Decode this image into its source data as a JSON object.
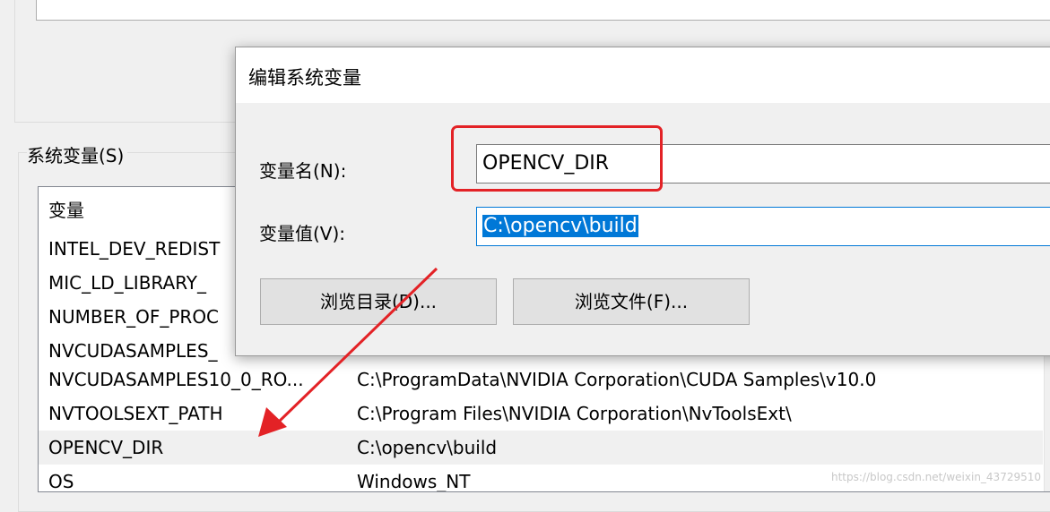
{
  "system_vars": {
    "label": "系统变量(S)",
    "header": "变量",
    "rows": [
      {
        "name": "INTEL_DEV_REDIST",
        "value": ""
      },
      {
        "name": "MIC_LD_LIBRARY_",
        "value": ""
      },
      {
        "name": "NUMBER_OF_PROC",
        "value": ""
      },
      {
        "name": "NVCUDASAMPLES_",
        "value": ""
      },
      {
        "name": "NVCUDASAMPLES10_0_RO...",
        "value": "C:\\ProgramData\\NVIDIA Corporation\\CUDA Samples\\v10.0"
      },
      {
        "name": "NVTOOLSEXT_PATH",
        "value": "C:\\Program Files\\NVIDIA Corporation\\NvToolsExt\\"
      },
      {
        "name": "OPENCV_DIR",
        "value": "C:\\opencv\\build"
      },
      {
        "name": "OS",
        "value": "Windows_NT"
      }
    ]
  },
  "dialog": {
    "title": "编辑系统变量",
    "name_label": "变量名(N):",
    "name_value": "OPENCV_DIR",
    "value_label": "变量值(V):",
    "value_value": "C:\\opencv\\build",
    "browse_dir_button": "浏览目录(D)...",
    "browse_file_button": "浏览文件(F)..."
  },
  "annotation": {
    "color": "#e32226"
  },
  "watermark": "https://blog.csdn.net/weixin_43729510"
}
